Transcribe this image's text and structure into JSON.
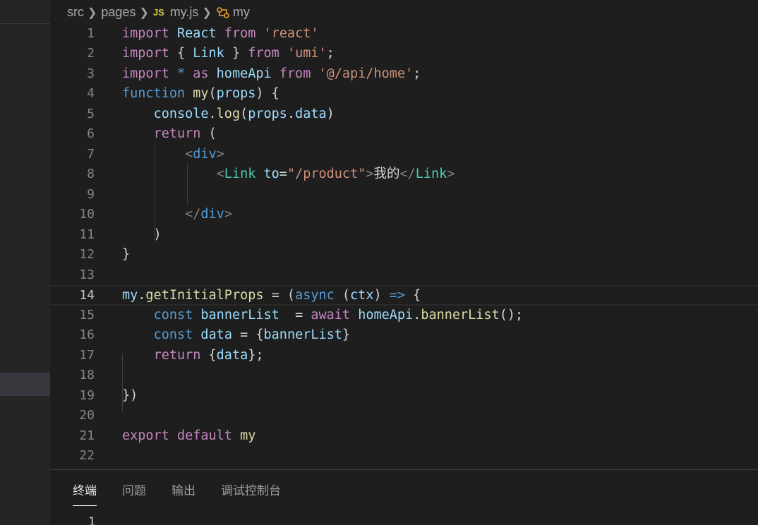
{
  "breadcrumb": {
    "items": [
      "src",
      "pages",
      "my.js",
      "my"
    ],
    "file_icon": "JS"
  },
  "editor": {
    "active_line": 14,
    "lines": [
      {
        "n": "1"
      },
      {
        "n": "2"
      },
      {
        "n": "3"
      },
      {
        "n": "4"
      },
      {
        "n": "5"
      },
      {
        "n": "6"
      },
      {
        "n": "7"
      },
      {
        "n": "8"
      },
      {
        "n": "9"
      },
      {
        "n": "10"
      },
      {
        "n": "11"
      },
      {
        "n": "12"
      },
      {
        "n": "13"
      },
      {
        "n": "14"
      },
      {
        "n": "15"
      },
      {
        "n": "16"
      },
      {
        "n": "17"
      },
      {
        "n": "18"
      },
      {
        "n": "19"
      },
      {
        "n": "20"
      },
      {
        "n": "21"
      },
      {
        "n": "22"
      }
    ],
    "tokens": [
      [
        [
          "kw",
          "import"
        ],
        [
          "pl",
          " "
        ],
        [
          "vr",
          "React"
        ],
        [
          "pl",
          " "
        ],
        [
          "kw",
          "from"
        ],
        [
          "pl",
          " "
        ],
        [
          "st",
          "'react'"
        ]
      ],
      [
        [
          "kw",
          "import"
        ],
        [
          "pl",
          " { "
        ],
        [
          "vr",
          "Link"
        ],
        [
          "pl",
          " } "
        ],
        [
          "kw",
          "from"
        ],
        [
          "pl",
          " "
        ],
        [
          "st",
          "'umi'"
        ],
        [
          "pl",
          ";"
        ]
      ],
      [
        [
          "kw",
          "import"
        ],
        [
          "pl",
          " "
        ],
        [
          "bl",
          "*"
        ],
        [
          "pl",
          " "
        ],
        [
          "kw",
          "as"
        ],
        [
          "pl",
          " "
        ],
        [
          "vr",
          "homeApi"
        ],
        [
          "pl",
          " "
        ],
        [
          "kw",
          "from"
        ],
        [
          "pl",
          " "
        ],
        [
          "st",
          "'@/api/home'"
        ],
        [
          "pl",
          ";"
        ]
      ],
      [
        [
          "bl",
          "function"
        ],
        [
          "pl",
          " "
        ],
        [
          "fn",
          "my"
        ],
        [
          "pl",
          "("
        ],
        [
          "vr",
          "props"
        ],
        [
          "pl",
          ") {"
        ]
      ],
      [
        [
          "pl",
          "    "
        ],
        [
          "vr",
          "console"
        ],
        [
          "pl",
          "."
        ],
        [
          "fn",
          "log"
        ],
        [
          "pl",
          "("
        ],
        [
          "vr",
          "props"
        ],
        [
          "pl",
          "."
        ],
        [
          "vr",
          "data"
        ],
        [
          "pl",
          ")"
        ]
      ],
      [
        [
          "pl",
          "    "
        ],
        [
          "kw",
          "return"
        ],
        [
          "pl",
          " ("
        ]
      ],
      [
        [
          "pl",
          "        "
        ],
        [
          "gr",
          "<"
        ],
        [
          "bl",
          "div"
        ],
        [
          "gr",
          ">"
        ]
      ],
      [
        [
          "pl",
          "            "
        ],
        [
          "gr",
          "<"
        ],
        [
          "tg",
          "Link"
        ],
        [
          "pl",
          " "
        ],
        [
          "vr",
          "to"
        ],
        [
          "pl",
          "="
        ],
        [
          "st",
          "\"/product\""
        ],
        [
          "gr",
          ">"
        ],
        [
          "pl",
          "我的"
        ],
        [
          "gr",
          "</"
        ],
        [
          "tg",
          "Link"
        ],
        [
          "gr",
          ">"
        ]
      ],
      [],
      [
        [
          "pl",
          "        "
        ],
        [
          "gr",
          "</"
        ],
        [
          "bl",
          "div"
        ],
        [
          "gr",
          ">"
        ]
      ],
      [
        [
          "pl",
          "    )"
        ]
      ],
      [
        [
          "pl",
          "}"
        ]
      ],
      [],
      [
        [
          "vr",
          "my"
        ],
        [
          "pl",
          "."
        ],
        [
          "fn",
          "getInitialProps"
        ],
        [
          "pl",
          " = ("
        ],
        [
          "bl",
          "async"
        ],
        [
          "pl",
          " ("
        ],
        [
          "vr",
          "ctx"
        ],
        [
          "pl",
          ") "
        ],
        [
          "bl",
          "=>"
        ],
        [
          "pl",
          " {"
        ]
      ],
      [
        [
          "pl",
          "    "
        ],
        [
          "bl",
          "const"
        ],
        [
          "pl",
          " "
        ],
        [
          "vr",
          "bannerList"
        ],
        [
          "pl",
          "  = "
        ],
        [
          "kw",
          "await"
        ],
        [
          "pl",
          " "
        ],
        [
          "vr",
          "homeApi"
        ],
        [
          "pl",
          "."
        ],
        [
          "fn",
          "bannerList"
        ],
        [
          "pl",
          "();"
        ]
      ],
      [
        [
          "pl",
          "    "
        ],
        [
          "bl",
          "const"
        ],
        [
          "pl",
          " "
        ],
        [
          "vr",
          "data"
        ],
        [
          "pl",
          " = {"
        ],
        [
          "vr",
          "bannerList"
        ],
        [
          "pl",
          "}"
        ]
      ],
      [
        [
          "pl",
          "    "
        ],
        [
          "kw",
          "return"
        ],
        [
          "pl",
          " {"
        ],
        [
          "vr",
          "data"
        ],
        [
          "pl",
          "};"
        ]
      ],
      [],
      [
        [
          "pl",
          "}"
        ],
        [
          "pl",
          ")"
        ]
      ],
      [],
      [
        [
          "kw",
          "export"
        ],
        [
          "pl",
          " "
        ],
        [
          "kw",
          "default"
        ],
        [
          "pl",
          " "
        ],
        [
          "fn",
          "my"
        ]
      ],
      []
    ]
  },
  "panel": {
    "tabs": [
      "终端",
      "问题",
      "输出",
      "调试控制台"
    ],
    "active_tab": 0,
    "terminal_line": "1"
  }
}
